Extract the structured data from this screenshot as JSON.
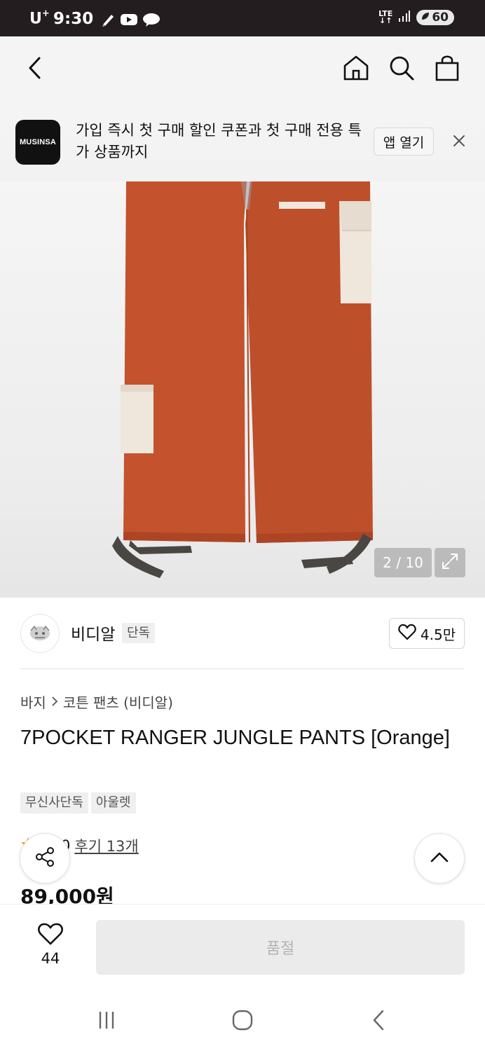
{
  "status_bar": {
    "carrier": "U",
    "carrier_sup": "+",
    "time": "9:30",
    "network": "LTE",
    "battery": "60",
    "icons": [
      "sketch-app-icon",
      "youtube-icon",
      "chat-bubble-icon",
      "signal-icon"
    ]
  },
  "nav": {
    "icons": [
      "back-arrow-icon",
      "home-icon",
      "search-icon",
      "shopping-bag-icon"
    ]
  },
  "banner": {
    "logo_text": "MUSINSA",
    "message": "가입 즉시 첫 구매 할인 쿠폰과 첫 구매 전용 특가 상품까지",
    "open_button": "앱 열기"
  },
  "gallery": {
    "counter": "2 / 10"
  },
  "brand": {
    "name": "비디알",
    "tag": "단독",
    "like_count": "4.5만"
  },
  "product": {
    "breadcrumb": [
      "바지",
      "코튼 팬츠 (비디알)"
    ],
    "title": "7POCKET RANGER JUNGLE PANTS [Orange]",
    "tags": [
      "무신사단독",
      "아울렛"
    ],
    "rating_partial": "0",
    "review_link": "후기 13개",
    "price": "89,000원"
  },
  "actions": {
    "wish_count": "44",
    "soldout_label": "품절"
  },
  "colors": {
    "pants": "#c3522d",
    "pocket": "#efe6dc",
    "strap": "#4a4742",
    "star": "#f5a623"
  }
}
